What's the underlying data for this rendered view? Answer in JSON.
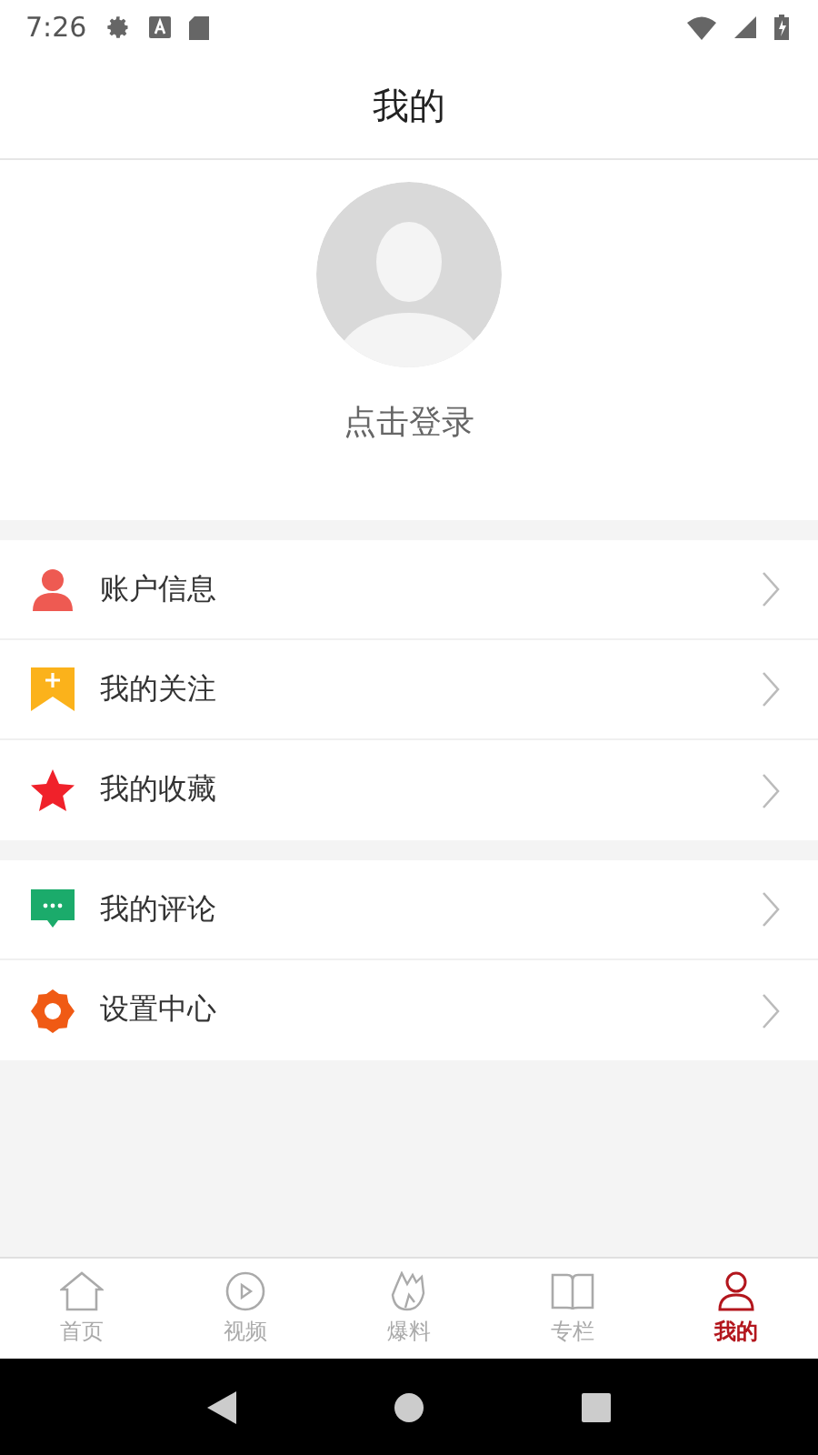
{
  "status_bar": {
    "time": "7:26"
  },
  "header": {
    "title": "我的"
  },
  "profile": {
    "login_label": "点击登录"
  },
  "menu_groups": [
    {
      "items": [
        {
          "kind": "person",
          "label": "账户信息"
        },
        {
          "kind": "bookmark",
          "label": "我的关注"
        },
        {
          "kind": "star",
          "label": "我的收藏"
        }
      ]
    },
    {
      "items": [
        {
          "kind": "comment",
          "label": "我的评论"
        },
        {
          "kind": "gear",
          "label": "设置中心"
        }
      ]
    }
  ],
  "tab_bar": [
    {
      "kind": "home",
      "label": "首页",
      "selected": false
    },
    {
      "kind": "play",
      "label": "视频",
      "selected": false
    },
    {
      "kind": "fire",
      "label": "爆料",
      "selected": false
    },
    {
      "kind": "book",
      "label": "专栏",
      "selected": false
    },
    {
      "kind": "person",
      "label": "我的",
      "selected": true
    }
  ]
}
